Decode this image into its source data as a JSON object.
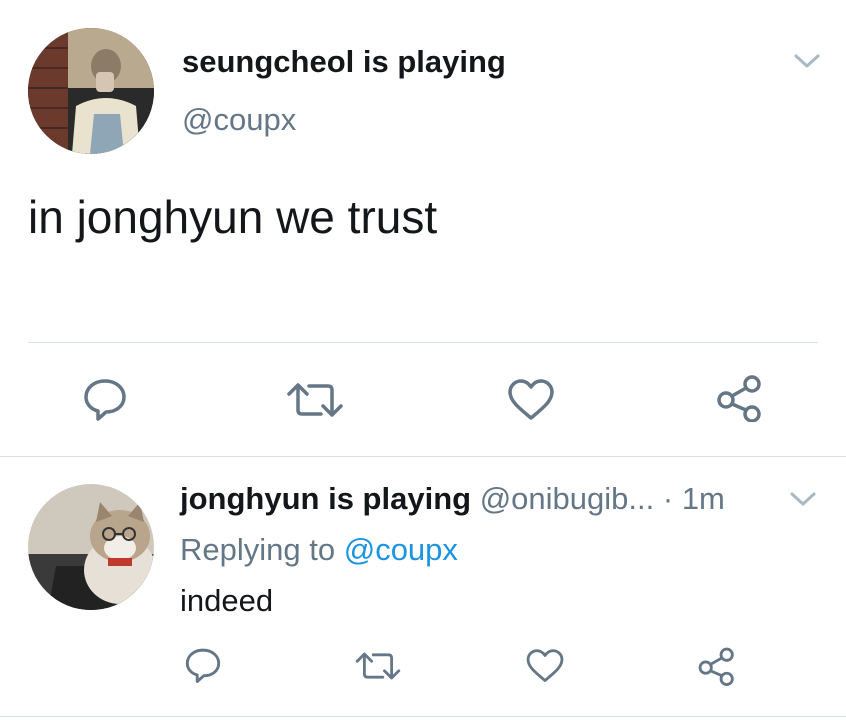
{
  "main_tweet": {
    "display_name": "seungcheol is playing",
    "handle": "@coupx",
    "text": "in jonghyun we trust",
    "avatar": "user-photo-avatar",
    "actions": [
      "reply-icon",
      "retweet-icon",
      "like-icon",
      "share-icon"
    ]
  },
  "reply_tweet": {
    "display_name": "jonghyun is playing",
    "handle": "@onibugib...",
    "separator": "·",
    "time": "1m",
    "replying_prefix": "Replying to",
    "replying_handle": "@coupx",
    "text": "indeed",
    "avatar": "cat-photo-avatar",
    "actions": [
      "reply-icon",
      "retweet-icon",
      "like-icon",
      "share-icon"
    ]
  },
  "colors": {
    "text": "#14171a",
    "muted": "#657786",
    "link": "#1b95e0",
    "divider": "#d8e1e8"
  }
}
